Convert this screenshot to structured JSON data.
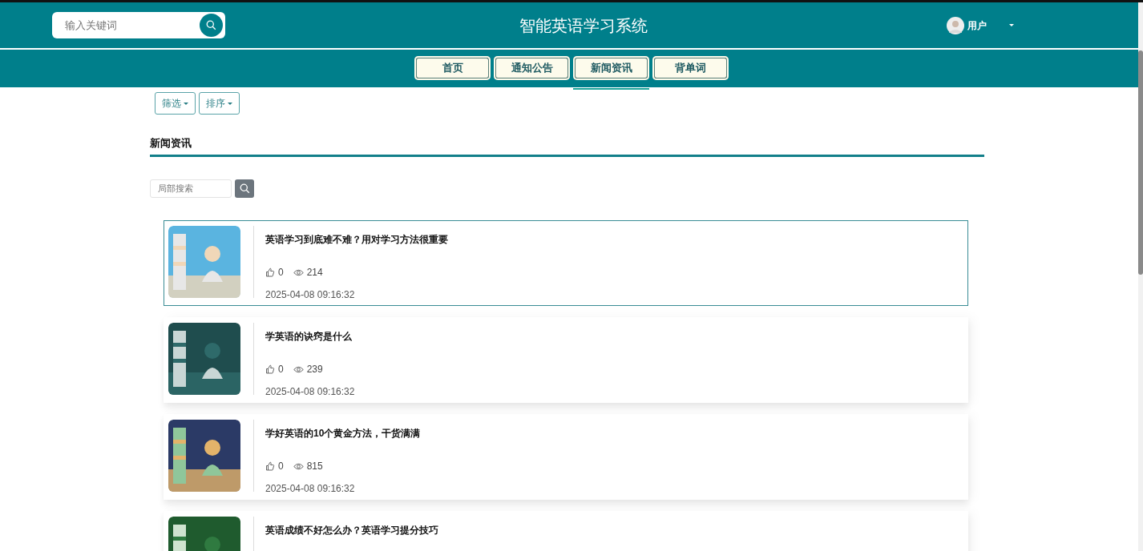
{
  "header": {
    "search": {
      "placeholder": "输入关键词"
    },
    "title": "智能英语学习系统",
    "user": {
      "name": "用户"
    }
  },
  "nav": [
    {
      "label": "首页",
      "selected": false
    },
    {
      "label": "通知公告",
      "selected": false
    },
    {
      "label": "新闻资讯",
      "selected": true
    },
    {
      "label": "背单词",
      "selected": false
    }
  ],
  "toolbar": [
    "筛选",
    "排序"
  ],
  "section": {
    "title": "新闻资讯",
    "search": {
      "placeholder": "局部搜索"
    }
  },
  "news": [
    {
      "title": "英语学习到底难不难？用对学习方法很重要",
      "likes": "0",
      "views": "214",
      "date": "2025-04-08 09:16:32",
      "highlighted": true,
      "kind": "picture"
    },
    {
      "title": "学英语的诀窍是什么",
      "likes": "0",
      "views": "239",
      "date": "2025-04-08 09:16:32",
      "highlighted": false,
      "kind": "picture"
    },
    {
      "title": "学好英语的10个黄金方法，干货满满",
      "likes": "0",
      "views": "815",
      "date": "2025-04-08 09:16:32",
      "highlighted": false,
      "kind": "picture"
    },
    {
      "title": "英语成绩不好怎么办？英语学习提分技巧",
      "highlighted": false,
      "kind": "picture"
    }
  ]
}
